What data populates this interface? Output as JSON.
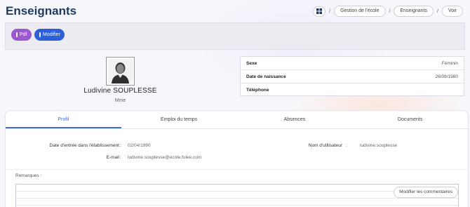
{
  "page": {
    "title": "Enseignants"
  },
  "breadcrumb": {
    "home_icon": "grid-icon",
    "items": [
      "Gestion de l'école",
      "Enseignants",
      "Voir"
    ],
    "separator": "/"
  },
  "toolbar": {
    "pdf_label": "Pdf",
    "modify_label": "Modifier"
  },
  "profile": {
    "name": "Ludivine SOUPLESSE",
    "civility": "Mme"
  },
  "info": {
    "rows": [
      {
        "label": "Sexe",
        "value": "Féminin"
      },
      {
        "label": "Date de naissance",
        "value": "26/08/1980"
      },
      {
        "label": "Téléphone",
        "value": ""
      }
    ]
  },
  "tabs": [
    "Profil",
    "Emploi du temps",
    "Absences",
    "Documents"
  ],
  "details": {
    "entry_date_label": "Date d'entrée dans l'établissement",
    "entry_date_value": "02/04/1990",
    "email_label": "E-mail",
    "email_value": "ludivine.souplesse@ecole.fulee.com",
    "username_label": "Nom d'utilisateur",
    "username_value": "ludivine.souplesse",
    "colon": ":"
  },
  "remarks": {
    "label": "Remarques :",
    "button_label": "Modifier les commentaires"
  },
  "colors": {
    "accent": "#3a6fd8",
    "pdf": "#9b59d0",
    "modify": "#2d5fd6",
    "title": "#1f3a5f"
  }
}
